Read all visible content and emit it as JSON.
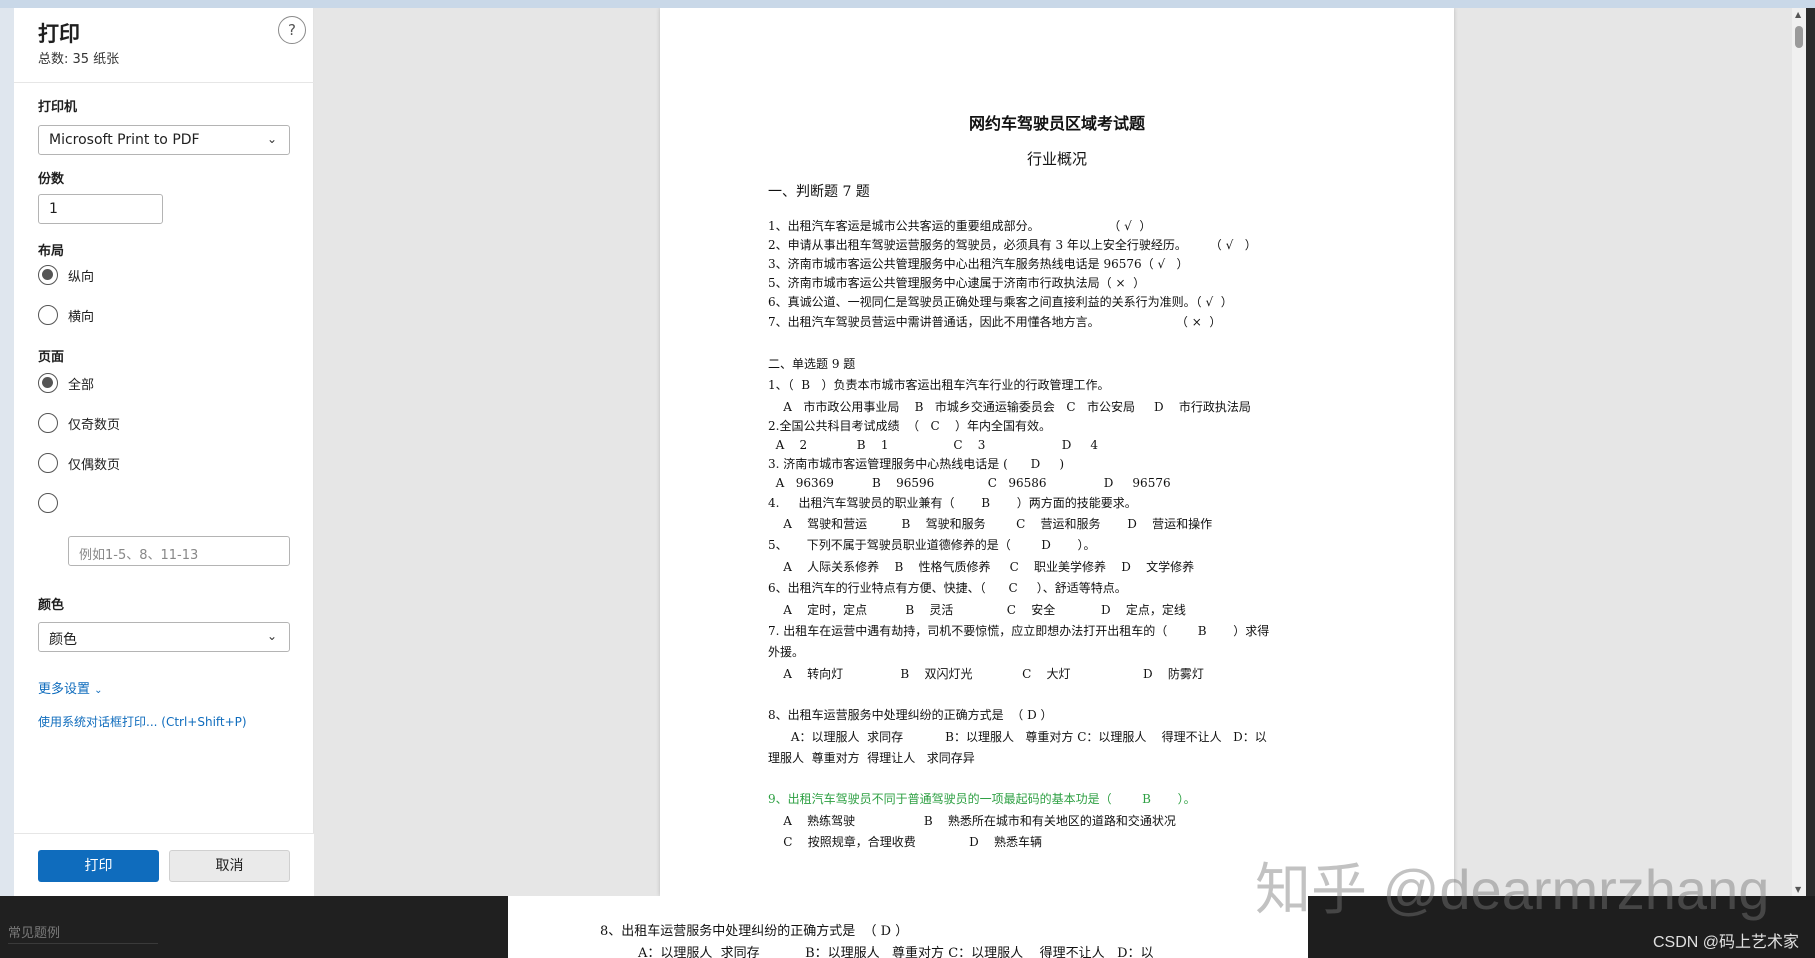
{
  "dialog": {
    "title": "打印",
    "subtitle": "总数: 35 纸张",
    "help": "?"
  },
  "printer": {
    "label": "打印机",
    "value": "Microsoft Print to PDF"
  },
  "copies": {
    "label": "份数",
    "value": "1"
  },
  "layout": {
    "label": "布局",
    "options": [
      {
        "label": "纵向",
        "selected": true
      },
      {
        "label": "横向",
        "selected": false
      }
    ]
  },
  "pages": {
    "label": "页面",
    "options": [
      {
        "label": "全部",
        "selected": true
      },
      {
        "label": "仅奇数页",
        "selected": false
      },
      {
        "label": "仅偶数页",
        "selected": false
      }
    ],
    "range_placeholder": "例如1-5、8、11-13"
  },
  "color": {
    "label": "颜色",
    "value": "颜色"
  },
  "more_settings": "更多设置",
  "system_dialog": "使用系统对话框打印... (Ctrl+Shift+P)",
  "buttons": {
    "print": "打印",
    "cancel": "取消"
  },
  "document": {
    "title": "网约车驾驶员区域考试题",
    "subtitle": "行业概况",
    "section1": "一、判断题 7 题",
    "judge": [
      "1、出租汽车客运是城市公共客运的重要组成部分。                  （ √  ）",
      "2、申请从事出租车驾驶运营服务的驾驶员，必须具有 3 年以上安全行驶经历。      （ √   ）",
      "3、济南市城市客运公共管理服务中心出租汽车服务热线电话是 96576（ √   ）",
      "5、济南市城市客运公共管理服务中心逮属于济南市行政执法局（ ×  ）",
      "6、真诚公道、一视同仁是驾驶员正确处理与乘客之间直接利益的关系行为准则。（ √  ）",
      "7、出租汽车驾驶员营运中需讲普通话，因此不用懂各地方言。                    （ ×  ）"
    ],
    "section2": "二、单选题 9 题",
    "single": [
      "1、（  B   ）负责本市城市客运出租车汽车行业的行政管理工作。",
      "    A   市市政公用事业局    B   市城乡交通运输委员会   C   市公安局     D    市行政执法局",
      "2.全国公共科目考试成绩  （   C    ）年内全国有效。",
      "  A    2             B    1                 C    3                    D     4",
      "3. 济南市城市客运管理服务中心热线电话是 (      D     )",
      "  A   96369          B    96596              C   96586               D     96576",
      "4.     出租汽车驾驶员的职业兼有（       B       ）两方面的技能要求。",
      "    A    驾驶和营运         B    驾驶和服务        C    营运和服务       D    营运和操作",
      "5、     下列不属于驾驶员职业道德修养的是（        D       ）。",
      "    A    人际关系修养    B    性格气质修养     C    职业美学修养    D    文学修养",
      "6、出租汽车的行业特点有方便、快捷、（      C     ）、舒适等特点。",
      "    A    定时，定点          B    灵活              C    安全            D    定点，定线",
      "7. 出租车在运营中遇有劫持，司机不要惊慌，应立即想办法打开出租车的（        B       ）求得",
      "外援。",
      "    A    转向灯               B    双闪灯光             C    大灯                   D    防雾灯",
      "8、出租车运营服务中处理纠纷的正确方式是  （ D ）",
      "      A：以理服人  求同存           B：以理服人   尊重对方 C：以理服人    得理不让人   D：以",
      "理服人  尊重对方  得理让人   求同存异",
      "9、出租汽车驾驶员不同于普通驾驶员的一项最起码的基本功是（        B       ）。",
      "    A    熟练驾驶                  B    熟悉所在城市和有关地区的道路和交通状况",
      "    C    按照规章，合理收费              D    熟悉车辆"
    ]
  },
  "background": {
    "select_text": "常见题例",
    "q8_line1": "8、出租车运营服务中处理纠纷的正确方式是  （ D ）",
    "q8_line2": "A：以理服人  求同存           B：以理服人   尊重对方 C：以理服人    得理不让人   D：以"
  },
  "watermark": "知乎 @dearmrzhang",
  "csdn": "CSDN @码上艺术家"
}
